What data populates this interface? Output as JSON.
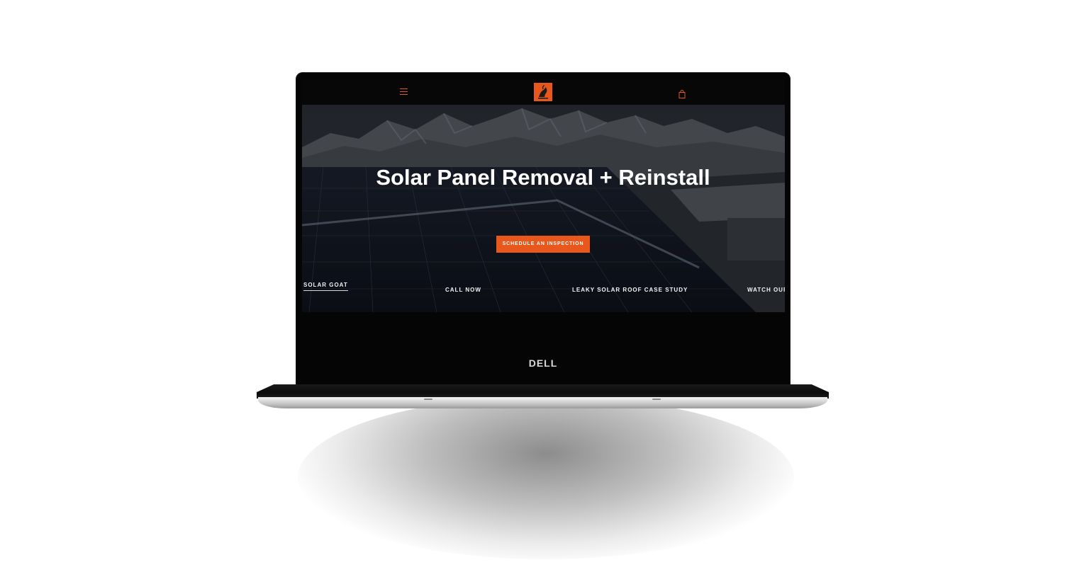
{
  "site": {
    "hero_title": "Solar Panel Removal + Reinstall",
    "cta_label": "SCHEDULE AN INSPECTION",
    "nav": [
      {
        "label": "SOLAR GOAT",
        "active": true
      },
      {
        "label": "CALL NOW"
      },
      {
        "label": "LEAKY SOLAR ROOF CASE STUDY"
      },
      {
        "label": "WATCH OUR"
      }
    ]
  },
  "icons": {
    "menu": "hamburger-menu-icon",
    "logo": "goat-logo-icon",
    "cart": "shopping-bag-icon"
  },
  "device": {
    "brand": "DELL"
  },
  "colors": {
    "accent": "#e8571b",
    "screen_bg": "#070707",
    "text": "#ffffff"
  }
}
